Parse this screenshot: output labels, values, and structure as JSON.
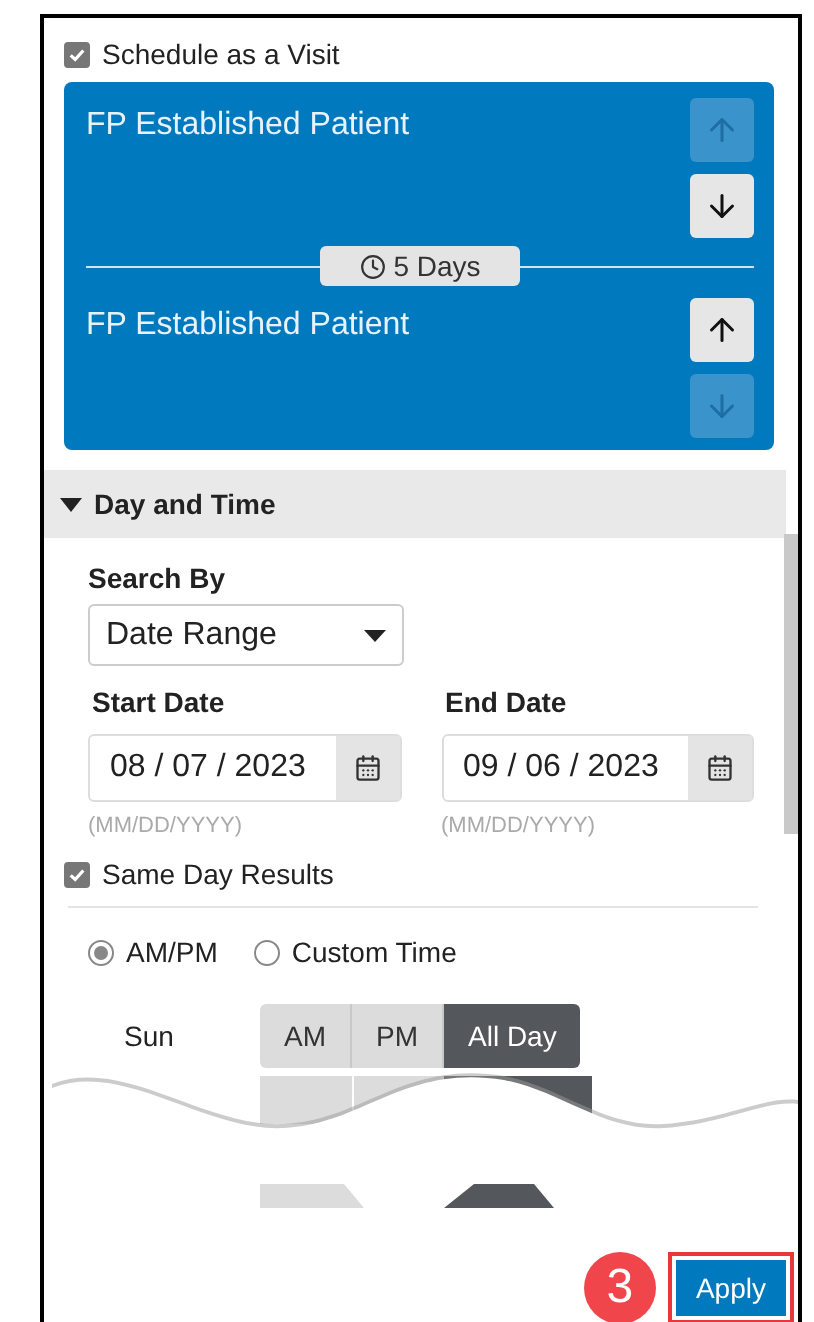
{
  "schedule_visit": {
    "label": "Schedule as a Visit",
    "checked": true
  },
  "visits": [
    {
      "name": "FP Established Patient",
      "up_disabled": true,
      "down_disabled": false
    },
    {
      "name": "FP Established Patient",
      "up_disabled": false,
      "down_disabled": true
    }
  ],
  "interval": {
    "label": "5 Days"
  },
  "section": {
    "title": "Day and Time",
    "expanded": true
  },
  "search_by": {
    "label": "Search By",
    "value": "Date Range"
  },
  "dates": [
    {
      "label": "Start Date",
      "value": "08 / 07 / 2023",
      "hint": "(MM/DD/YYYY)"
    },
    {
      "label": "End Date",
      "value": "09 / 06 / 2023",
      "hint": "(MM/DD/YYYY)"
    }
  ],
  "same_day": {
    "label": "Same Day Results",
    "checked": true
  },
  "time_mode": [
    {
      "label": "AM/PM",
      "selected": true
    },
    {
      "label": "Custom Time",
      "selected": false
    }
  ],
  "days": [
    {
      "day": "Sun",
      "options": [
        {
          "label": "AM",
          "selected": false
        },
        {
          "label": "PM",
          "selected": false
        },
        {
          "label": "All Day",
          "selected": true
        }
      ]
    }
  ],
  "step_badge": "3",
  "apply_button": "Apply"
}
